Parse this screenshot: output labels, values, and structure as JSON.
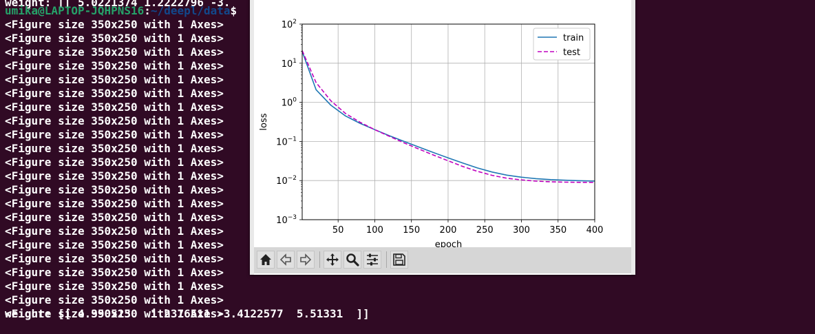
{
  "terminal": {
    "top_line": "weight: [[ 5.0221374 1.2222796 -3.",
    "prompt": {
      "user": "umika@LAPTOP-JQHPNS16",
      "sep": ":",
      "path": "~/deepl/data",
      "symbol": "$"
    },
    "figure_lines": [
      "<Figure size 350x250 with 1 Axes>",
      "<Figure size 350x250 with 1 Axes>",
      "<Figure size 350x250 with 1 Axes>",
      "<Figure size 350x250 with 1 Axes>",
      "<Figure size 350x250 with 1 Axes>",
      "<Figure size 350x250 with 1 Axes>",
      "<Figure size 350x250 with 1 Axes>",
      "<Figure size 350x250 with 1 Axes>",
      "<Figure size 350x250 with 1 Axes>",
      "<Figure size 350x250 with 1 Axes>",
      "<Figure size 350x250 with 1 Axes>",
      "<Figure size 350x250 with 1 Axes>",
      "<Figure size 350x250 with 1 Axes>",
      "<Figure size 350x250 with 1 Axes>",
      "<Figure size 350x250 with 1 Axes>",
      "<Figure size 350x250 with 1 Axes>",
      "<Figure size 350x250 with 1 Axes>",
      "<Figure size 350x250 with 1 Axes>",
      "<Figure size 350x250 with 1 Axes>",
      "<Figure size 350x250 with 1 Axes>",
      "<Figure size 350x250 with 1 Axes>",
      "<Figure size 350x250 with 1 Axes>"
    ],
    "last_line": "weight: [[ 4.990513   1.2376511 -3.4122577  5.51331  ]]",
    "colors": {
      "background": "#300a24",
      "text": "#ffffff",
      "user": "#26a269",
      "path": "#12488b"
    }
  },
  "toolbar": {
    "buttons": [
      {
        "name": "home",
        "icon": "home-icon"
      },
      {
        "name": "back",
        "icon": "arrow-left-icon"
      },
      {
        "name": "forward",
        "icon": "arrow-right-icon"
      },
      {
        "name": "pan",
        "icon": "move-icon"
      },
      {
        "name": "zoom",
        "icon": "magnifier-icon"
      },
      {
        "name": "configure",
        "icon": "sliders-icon"
      },
      {
        "name": "save",
        "icon": "floppy-disk-icon"
      }
    ]
  },
  "chart_data": {
    "type": "line",
    "title": "",
    "xlabel": "epoch",
    "ylabel": "loss",
    "xlim": [
      1,
      400
    ],
    "ylim": [
      0.001,
      100
    ],
    "yscale": "log",
    "xticks": [
      50,
      100,
      150,
      200,
      250,
      300,
      350,
      400
    ],
    "yticks": [
      {
        "value": 100,
        "label_base": "10",
        "label_exp": "2"
      },
      {
        "value": 10,
        "label_base": "10",
        "label_exp": "1"
      },
      {
        "value": 1,
        "label_base": "10",
        "label_exp": "0"
      },
      {
        "value": 0.1,
        "label_base": "10",
        "label_exp": "−1"
      },
      {
        "value": 0.01,
        "label_base": "10",
        "label_exp": "−2"
      },
      {
        "value": 0.001,
        "label_base": "10",
        "label_exp": "−3"
      }
    ],
    "grid": true,
    "legend_position": "top-right",
    "series": [
      {
        "name": "train",
        "color": "#1f77b4",
        "style": "solid",
        "x": [
          1,
          20,
          40,
          60,
          80,
          100,
          120,
          140,
          160,
          180,
          200,
          220,
          240,
          260,
          280,
          300,
          320,
          340,
          360,
          380,
          400
        ],
        "y": [
          20,
          2.1,
          0.85,
          0.45,
          0.29,
          0.2,
          0.14,
          0.1,
          0.072,
          0.052,
          0.038,
          0.028,
          0.021,
          0.0165,
          0.0138,
          0.0122,
          0.0112,
          0.0106,
          0.0102,
          0.0099,
          0.0097
        ]
      },
      {
        "name": "test",
        "color": "#bf00bf",
        "style": "dashed",
        "x": [
          1,
          20,
          40,
          60,
          80,
          100,
          120,
          140,
          160,
          180,
          200,
          220,
          240,
          260,
          280,
          300,
          320,
          340,
          360,
          380,
          400
        ],
        "y": [
          21,
          3.2,
          1.1,
          0.52,
          0.31,
          0.2,
          0.135,
          0.092,
          0.064,
          0.045,
          0.032,
          0.023,
          0.0172,
          0.0136,
          0.0115,
          0.0104,
          0.0097,
          0.0093,
          0.0091,
          0.009,
          0.009
        ]
      }
    ]
  }
}
